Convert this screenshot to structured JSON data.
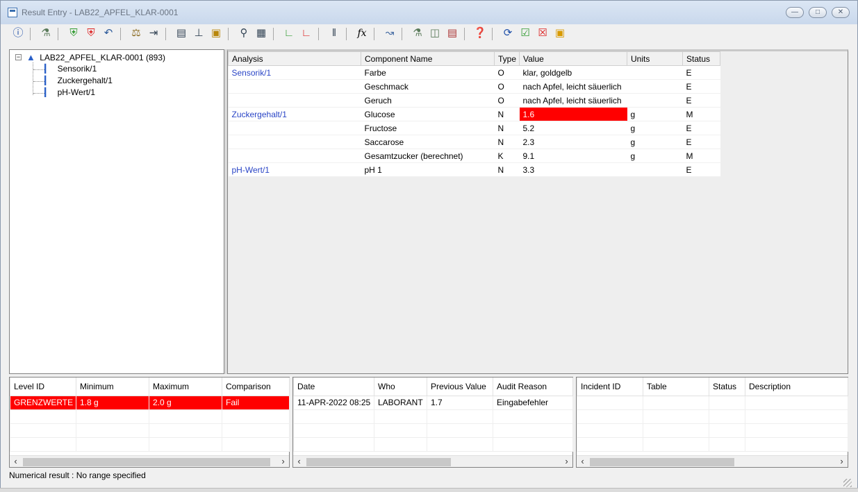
{
  "window": {
    "title": "Result Entry - LAB22_APFEL_KLAR-0001"
  },
  "toolbar": {
    "icons": [
      "info-icon",
      "flask-icon",
      "shield-green-icon",
      "shield-red-icon",
      "undo-icon",
      "balance-icon",
      "import-icon",
      "form-icon",
      "tree-icon",
      "lock-icon",
      "preview-icon",
      "calculator-icon",
      "chart-green-icon",
      "chart-red-icon",
      "tubes-icon",
      "function-icon",
      "trend-icon",
      "flask-check-icon",
      "container-icon",
      "clipboard-icon",
      "help-icon",
      "refresh-icon",
      "approve-icon",
      "reject-icon",
      "export-icon"
    ],
    "fx_label": "fx"
  },
  "tree": {
    "root_label": "LAB22_APFEL_KLAR-0001 (893)",
    "children": [
      "Sensorik/1",
      "Zuckergehalt/1",
      "pH-Wert/1"
    ]
  },
  "results": {
    "columns": [
      "Analysis",
      "Component Name",
      "Type",
      "Value",
      "Units",
      "Status"
    ],
    "rows": [
      {
        "analysis": "Sensorik/1",
        "component": "Farbe",
        "type": "O",
        "value": "klar, goldgelb",
        "units": "",
        "status": "E"
      },
      {
        "analysis": "",
        "component": "Geschmack",
        "type": "O",
        "value": "nach Apfel, leicht säuerlich",
        "units": "",
        "status": "E"
      },
      {
        "analysis": "",
        "component": "Geruch",
        "type": "O",
        "value": "nach Apfel, leicht säuerlich",
        "units": "",
        "status": "E"
      },
      {
        "analysis": "Zuckergehalt/1",
        "component": "Glucose",
        "type": "N",
        "value": "1.6",
        "units": "g",
        "status": "M"
      },
      {
        "analysis": "",
        "component": "Fructose",
        "type": "N",
        "value": "5.2",
        "units": "g",
        "status": "E"
      },
      {
        "analysis": "",
        "component": "Saccarose",
        "type": "N",
        "value": "2.3",
        "units": "g",
        "status": "E"
      },
      {
        "analysis": "",
        "component": "Gesamtzucker (berechnet)",
        "type": "K",
        "value": "9.1",
        "units": "g",
        "status": "M"
      },
      {
        "analysis": "pH-Wert/1",
        "component": "pH 1",
        "type": "N",
        "value": "3.3",
        "units": "",
        "status": "E"
      }
    ]
  },
  "limits": {
    "columns": [
      "Level ID",
      "Minimum",
      "Maximum",
      "Comparison"
    ],
    "row": {
      "level": "GRENZWERTE",
      "min": "1.8 g",
      "max": "2.0 g",
      "comparison": "Fail"
    }
  },
  "audit": {
    "columns": [
      "Date",
      "Who",
      "Previous Value",
      "Audit Reason"
    ],
    "row": {
      "date": "11-APR-2022 08:25",
      "who": "LABORANT",
      "previous": "1.7",
      "reason": "Eingabefehler"
    }
  },
  "incidents": {
    "columns": [
      "Incident ID",
      "Table",
      "Status",
      "Description"
    ]
  },
  "status": {
    "message": "Numerical result : No range specified"
  },
  "colors": {
    "fail_red": "#ff0000",
    "link_blue": "#2a45c6"
  }
}
